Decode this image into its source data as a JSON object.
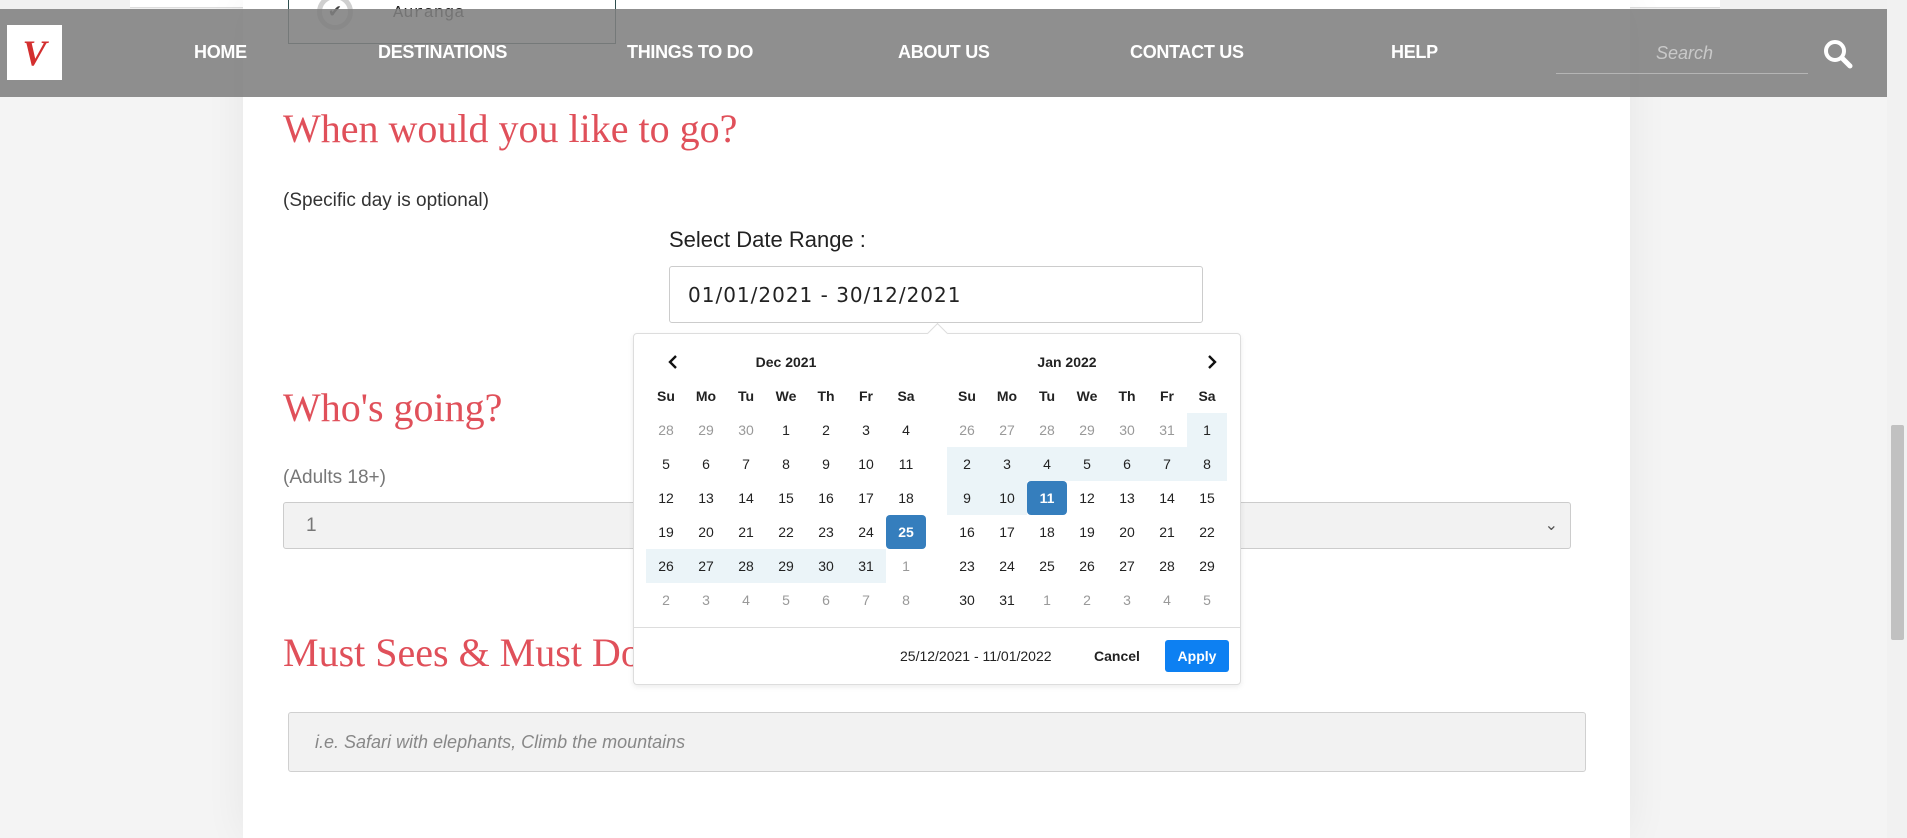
{
  "previous_option": {
    "label": "Auranga",
    "checked": true
  },
  "navbar": {
    "logo_text": "V",
    "items": [
      "HOME",
      "DESTINATIONS",
      "THINGS TO DO",
      "ABOUT US",
      "CONTACT US",
      "HELP"
    ],
    "search_placeholder": "Search"
  },
  "when": {
    "heading": "When would you like to go?",
    "note": "(Specific day is optional)",
    "range_label": "Select Date Range :",
    "range_value": "01/01/2021 - 30/12/2021"
  },
  "datepicker": {
    "left": {
      "title": "Dec 2021",
      "dow": [
        "Su",
        "Mo",
        "Tu",
        "We",
        "Th",
        "Fr",
        "Sa"
      ],
      "days": [
        {
          "d": "28",
          "s": "off"
        },
        {
          "d": "29",
          "s": "off"
        },
        {
          "d": "30",
          "s": "off"
        },
        {
          "d": "1",
          "s": ""
        },
        {
          "d": "2",
          "s": ""
        },
        {
          "d": "3",
          "s": ""
        },
        {
          "d": "4",
          "s": ""
        },
        {
          "d": "5",
          "s": ""
        },
        {
          "d": "6",
          "s": ""
        },
        {
          "d": "7",
          "s": ""
        },
        {
          "d": "8",
          "s": ""
        },
        {
          "d": "9",
          "s": ""
        },
        {
          "d": "10",
          "s": ""
        },
        {
          "d": "11",
          "s": ""
        },
        {
          "d": "12",
          "s": ""
        },
        {
          "d": "13",
          "s": ""
        },
        {
          "d": "14",
          "s": ""
        },
        {
          "d": "15",
          "s": ""
        },
        {
          "d": "16",
          "s": ""
        },
        {
          "d": "17",
          "s": ""
        },
        {
          "d": "18",
          "s": ""
        },
        {
          "d": "19",
          "s": ""
        },
        {
          "d": "20",
          "s": ""
        },
        {
          "d": "21",
          "s": ""
        },
        {
          "d": "22",
          "s": ""
        },
        {
          "d": "23",
          "s": ""
        },
        {
          "d": "24",
          "s": ""
        },
        {
          "d": "25",
          "s": "sel"
        },
        {
          "d": "26",
          "s": "inrange"
        },
        {
          "d": "27",
          "s": "inrange"
        },
        {
          "d": "28",
          "s": "inrange"
        },
        {
          "d": "29",
          "s": "inrange"
        },
        {
          "d": "30",
          "s": "inrange"
        },
        {
          "d": "31",
          "s": "inrange"
        },
        {
          "d": "1",
          "s": "off"
        },
        {
          "d": "2",
          "s": "off"
        },
        {
          "d": "3",
          "s": "off"
        },
        {
          "d": "4",
          "s": "off"
        },
        {
          "d": "5",
          "s": "off"
        },
        {
          "d": "6",
          "s": "off"
        },
        {
          "d": "7",
          "s": "off"
        },
        {
          "d": "8",
          "s": "off"
        }
      ]
    },
    "right": {
      "title": "Jan 2022",
      "dow": [
        "Su",
        "Mo",
        "Tu",
        "We",
        "Th",
        "Fr",
        "Sa"
      ],
      "days": [
        {
          "d": "26",
          "s": "off"
        },
        {
          "d": "27",
          "s": "off"
        },
        {
          "d": "28",
          "s": "off"
        },
        {
          "d": "29",
          "s": "off"
        },
        {
          "d": "30",
          "s": "off"
        },
        {
          "d": "31",
          "s": "off"
        },
        {
          "d": "1",
          "s": "inrange"
        },
        {
          "d": "2",
          "s": "inrange"
        },
        {
          "d": "3",
          "s": "inrange"
        },
        {
          "d": "4",
          "s": "inrange"
        },
        {
          "d": "5",
          "s": "inrange"
        },
        {
          "d": "6",
          "s": "inrange"
        },
        {
          "d": "7",
          "s": "inrange"
        },
        {
          "d": "8",
          "s": "inrange"
        },
        {
          "d": "9",
          "s": "inrange"
        },
        {
          "d": "10",
          "s": "inrange"
        },
        {
          "d": "11",
          "s": "sel"
        },
        {
          "d": "12",
          "s": ""
        },
        {
          "d": "13",
          "s": ""
        },
        {
          "d": "14",
          "s": ""
        },
        {
          "d": "15",
          "s": ""
        },
        {
          "d": "16",
          "s": ""
        },
        {
          "d": "17",
          "s": ""
        },
        {
          "d": "18",
          "s": ""
        },
        {
          "d": "19",
          "s": ""
        },
        {
          "d": "20",
          "s": ""
        },
        {
          "d": "21",
          "s": ""
        },
        {
          "d": "22",
          "s": ""
        },
        {
          "d": "23",
          "s": ""
        },
        {
          "d": "24",
          "s": ""
        },
        {
          "d": "25",
          "s": ""
        },
        {
          "d": "26",
          "s": ""
        },
        {
          "d": "27",
          "s": ""
        },
        {
          "d": "28",
          "s": ""
        },
        {
          "d": "29",
          "s": ""
        },
        {
          "d": "30",
          "s": ""
        },
        {
          "d": "31",
          "s": ""
        },
        {
          "d": "1",
          "s": "off"
        },
        {
          "d": "2",
          "s": "off"
        },
        {
          "d": "3",
          "s": "off"
        },
        {
          "d": "4",
          "s": "off"
        },
        {
          "d": "5",
          "s": "off"
        }
      ]
    },
    "selected_range": "25/12/2021 - 11/01/2022",
    "cancel_label": "Cancel",
    "apply_label": "Apply"
  },
  "who": {
    "heading": "Who's going?",
    "adults_label": "(Adults 18+)",
    "adults_value": "1"
  },
  "must": {
    "heading": "Must Sees & Must Do",
    "placeholder": "i.e. Safari with elephants, Climb the mountains"
  },
  "colors": {
    "heading": "#e0505a",
    "navbar": "#808080",
    "selected_day": "#357ebd",
    "range_day": "#ebf4f8",
    "apply_button": "#0d80f2"
  }
}
